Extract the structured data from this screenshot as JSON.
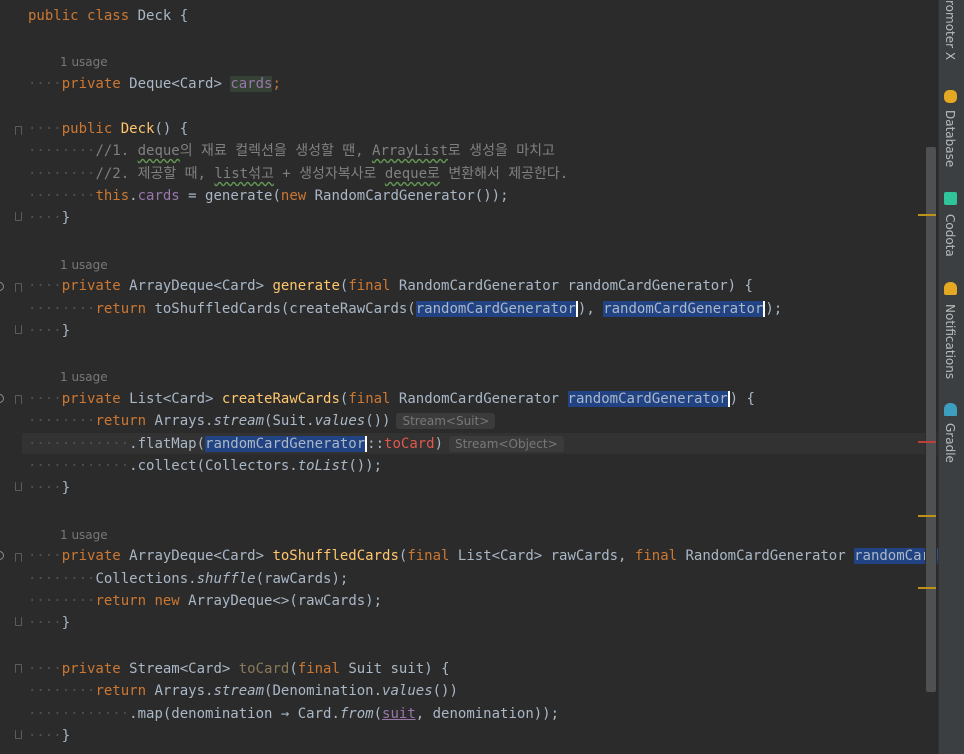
{
  "editor": {
    "usage_label": "1 usage",
    "code": {
      "class_kw1": "public",
      "class_kw2": "class",
      "class_name": "Deck",
      "open_brace": " {",
      "close_brace": "}",
      "field_kw": "private",
      "field_type": "Deque<Card>",
      "field_name": "cards",
      "semicolon": ";",
      "ctor_kw": "public",
      "ctor_name": "Deck",
      "ctor_params": "() {",
      "comment1_a": "//1. ",
      "comment1_b": "deque",
      "comment1_c": "의 재료 컬렉션을 생성할 땐, ",
      "comment1_d": "ArrayList",
      "comment1_e": "로 생성을 마치고",
      "comment2_a": "//2. 제공할 때, ",
      "comment2_b": "list섞고",
      "comment2_c": " + 생성자복사로 ",
      "comment2_d": "deque로",
      "comment2_e": " 변환해서 제공한다.",
      "this_kw": "this",
      "this_field": "cards",
      "assign_call": " = generate(",
      "new_kw": "new",
      "ctor_call": " RandomCardGenerator());",
      "gen_mod": "private",
      "gen_type": " ArrayDeque<Card> ",
      "gen_name": "generate",
      "paren_open": "(",
      "final_kw": "final",
      "gen_param": " RandomCardGenerator randomCardGenerator) {",
      "return_kw": "return",
      "gen_body_a": " toShuffledCards(createRawCards(",
      "param_name": "randomCardGenerator",
      "gen_body_b": "), ",
      "gen_body_c": ");",
      "create_mod": "private",
      "create_type": " List<Card> ",
      "create_name": "createRawCards",
      "create_param_a": " RandomCardGenerator ",
      "create_param_b": ") {",
      "create_body_a": " Arrays.",
      "stream_name": "stream",
      "create_body_b": "(Suit.",
      "values_name": "values",
      "create_body_c": "())",
      "hint1": "Stream<Suit>",
      "flatmap_a": ".flatMap(",
      "flatmap_b": "::",
      "flatmap_method": "toCard",
      "flatmap_c": ")",
      "hint2": "Stream<Object>",
      "collect_a": ".collect(Collectors.",
      "tolist_name": "toList",
      "collect_b": "());",
      "shuffle_mod": "private",
      "shuffle_type": " ArrayDeque<Card> ",
      "shuffle_name": "toShuffledCards",
      "shuffle_param_a": " List<Card> rawCards, ",
      "shuffle_param_b": " RandomCardGenerator ",
      "shuffle_param_c": "randomCardGenera",
      "shuffle_body_a": "Collections.",
      "shuffle_call": "shuffle",
      "shuffle_body_b": "(rawCards);",
      "new_deque": " ArrayDeque<>(rawCards);",
      "tocard_mod": "private",
      "tocard_type": " Stream<Card> ",
      "tocard_name": "toCard",
      "tocard_param": " Suit suit) {",
      "tocard_body_a": " Arrays.",
      "tocard_body_b": "(Denomination.",
      "tocard_body_c": "())",
      "map_a": ".map(denomination → Card.",
      "from_name": "from",
      "map_suit": "suit",
      "map_b": ", denomination));"
    }
  },
  "sidebar": {
    "tools": [
      {
        "label": "romoter X",
        "icon": "none"
      },
      {
        "label": "Database",
        "icon": "database-icon"
      },
      {
        "label": "Codota",
        "icon": "codota-icon"
      },
      {
        "label": "Notifications",
        "icon": "bell-icon"
      },
      {
        "label": "Gradle",
        "icon": "gradle-elephant-icon"
      }
    ]
  },
  "colors": {
    "background": "#2b2b2b",
    "keyword": "#cc7832",
    "method": "#ffc66d",
    "field": "#9876aa",
    "comment": "#808080",
    "selection": "#214283",
    "warning_mark": "#be9117",
    "error_mark": "#bc3f3c"
  }
}
